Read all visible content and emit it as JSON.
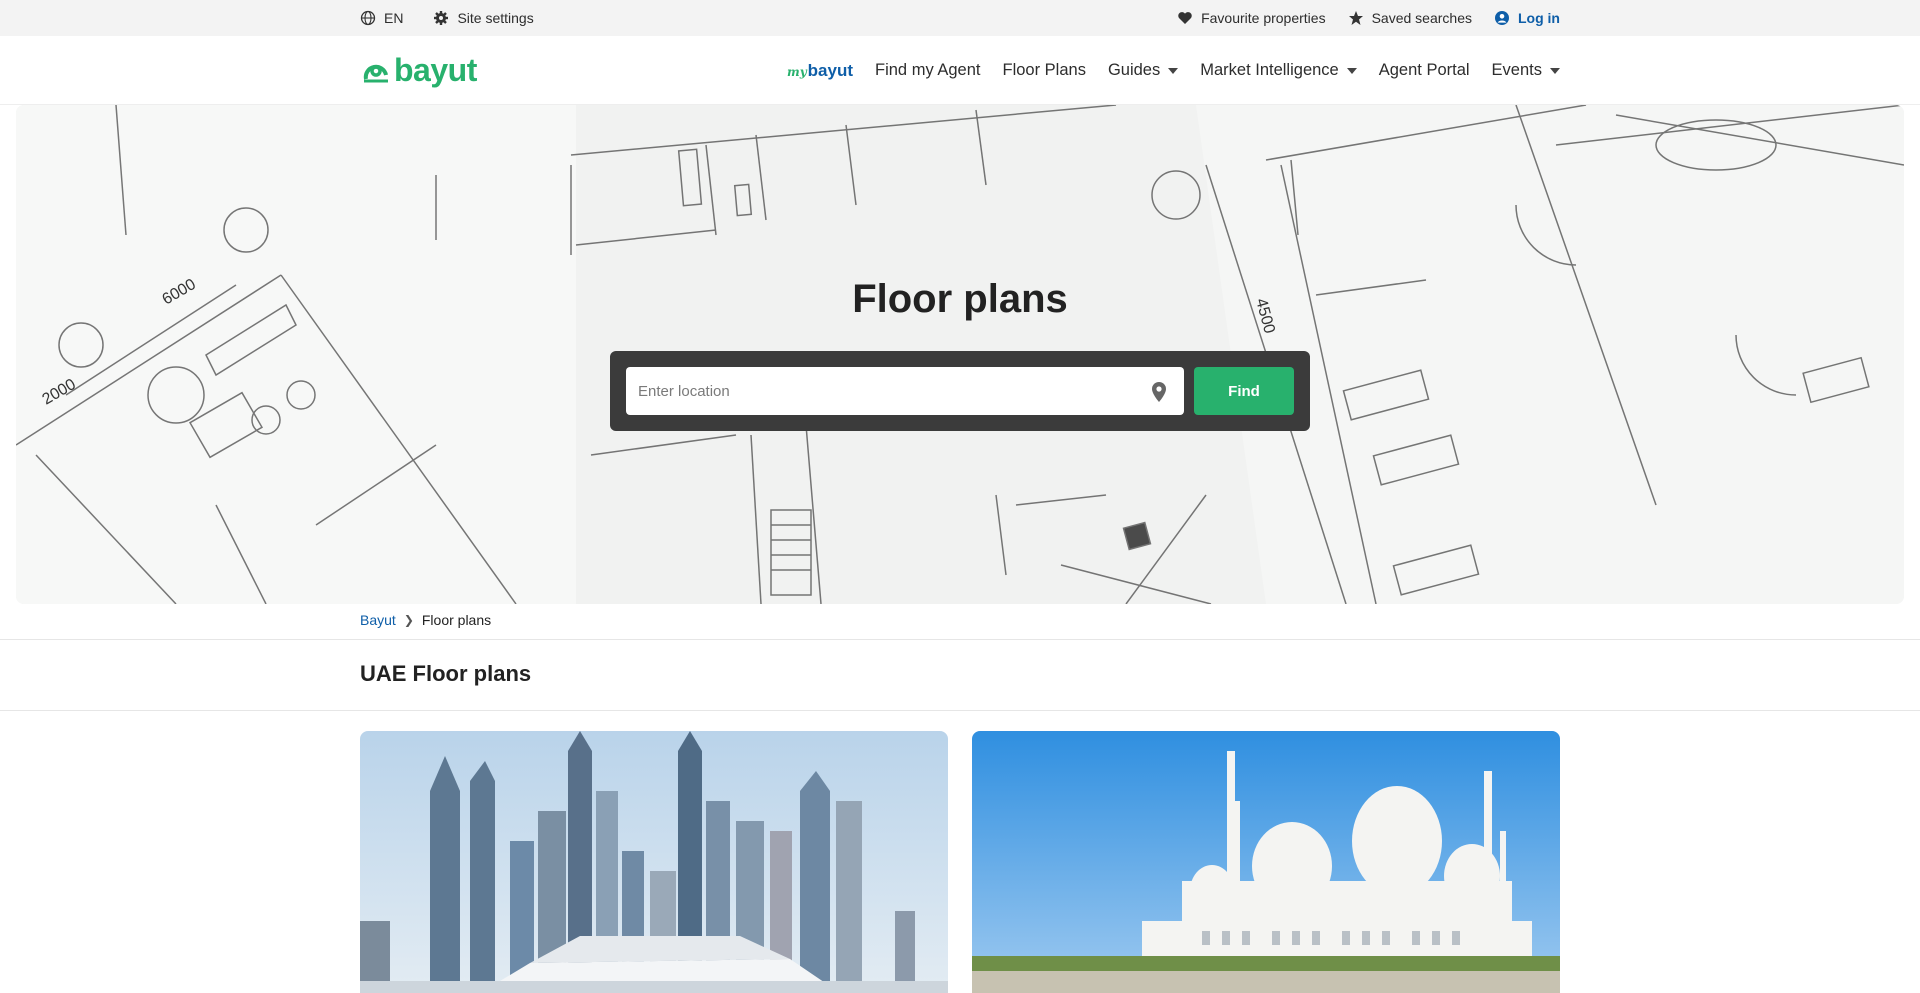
{
  "topbar": {
    "language": "EN",
    "site_settings": "Site settings",
    "favourites": "Favourite properties",
    "saved_searches": "Saved searches",
    "login": "Log in"
  },
  "nav": {
    "logo": "bayut",
    "mybayut_prefix": "my",
    "mybayut_word": "bayut",
    "links": [
      "Find my Agent",
      "Floor Plans",
      "Guides",
      "Market Intelligence",
      "Agent Portal",
      "Events"
    ]
  },
  "hero": {
    "title": "Floor plans",
    "search_placeholder": "Enter location",
    "find_label": "Find"
  },
  "breadcrumb": {
    "home": "Bayut",
    "current": "Floor plans"
  },
  "section": {
    "title": "UAE Floor plans"
  },
  "colors": {
    "brand_green": "#28b16d",
    "link_blue": "#0e5ea8",
    "search_bg": "#3b3b3b"
  }
}
